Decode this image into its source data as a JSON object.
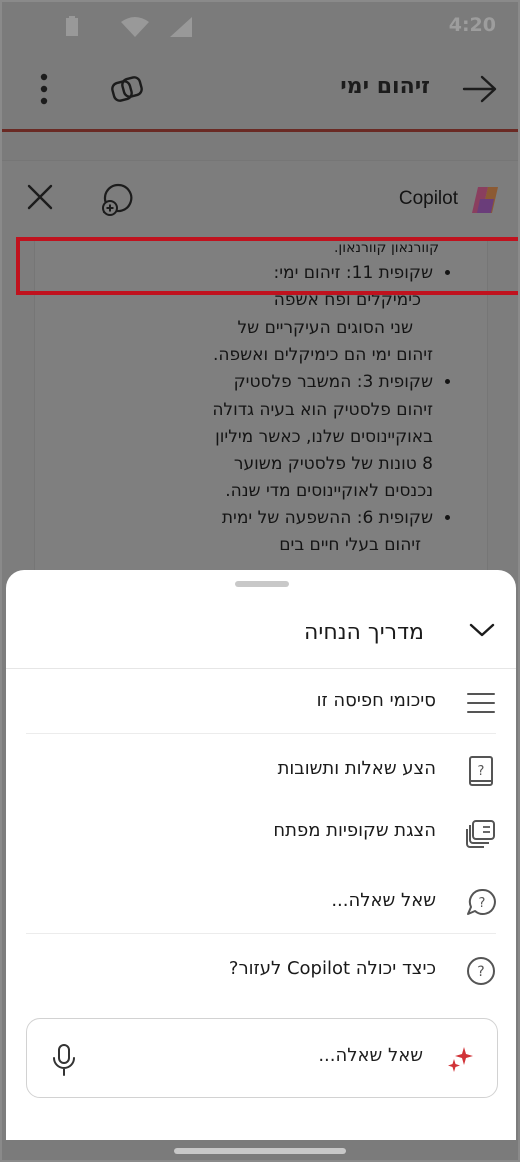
{
  "status_bar": {
    "time": "4:20"
  },
  "app_header": {
    "title": "זיהום ימי"
  },
  "copilot": {
    "name": "Copilot"
  },
  "chat": {
    "cut_text": "קוורנאון קוורנאון.",
    "bullets": [
      {
        "heading": "שקופית 11: זיהום ימי:",
        "line2": "כימיקלים ופח אשפה"
      },
      {
        "heading": "שקופית 3: המשבר פלסטיק",
        "line2": ""
      },
      {
        "heading": "שקופית 6: ההשפעה של ימית",
        "line2": "זיהום בעלי חיים בים"
      }
    ],
    "body1": [
      "שני הסוגים העיקריים של",
      "זיהום ימי הם כימיקלים ואשפה."
    ],
    "body2": [
      "זיהום פלסטיק הוא בעיה גדולה",
      "באוקיינוסים שלנו, כאשר מיליון",
      "8 טונות של פלסטיק משוער",
      "נכנסים לאוקיינוסים מדי שנה."
    ]
  },
  "sheet": {
    "title": "מדריך הנחיה",
    "items": [
      {
        "label": "סיכומי חפיסה זו",
        "icon": "summary-lines-icon"
      },
      {
        "label": "הצע שאלות ותשובות",
        "icon": "qa-book-icon"
      },
      {
        "label": "הצגת שקופיות מפתח",
        "icon": "slides-stack-icon"
      },
      {
        "label": "שאל שאלה...",
        "icon": "question-bubble-icon"
      },
      {
        "label": "כיצד יכולה Copilot לעזור?",
        "icon": "help-circle-icon"
      }
    ]
  },
  "input": {
    "placeholder": "שאל שאלה..."
  },
  "colors": {
    "highlight": "#c0121e",
    "accent_line": "#6a2a24"
  }
}
